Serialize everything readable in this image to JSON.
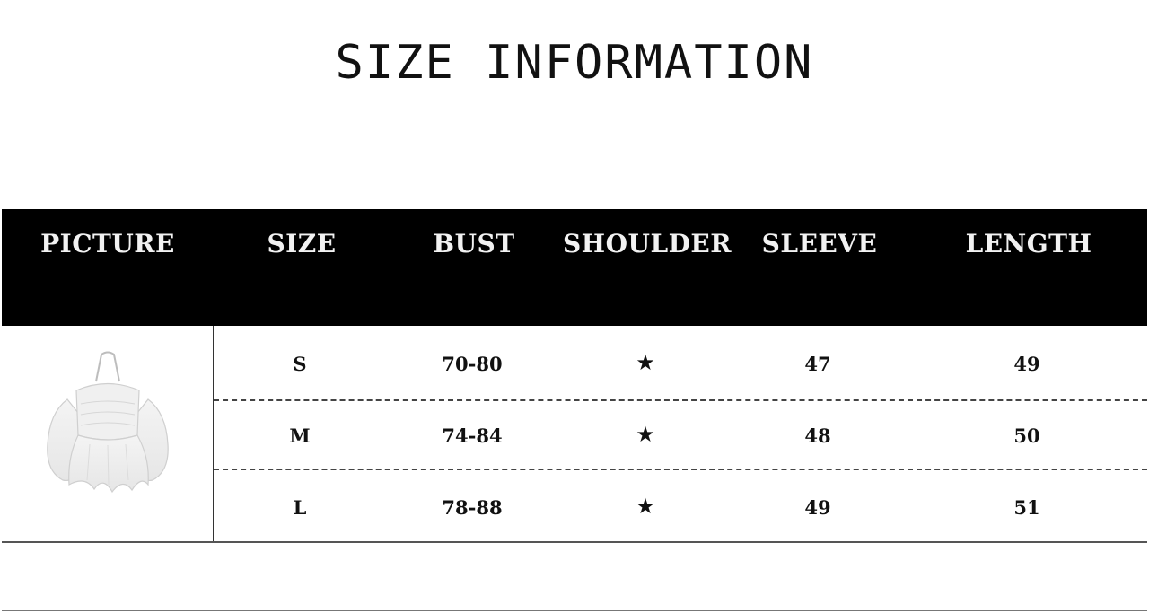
{
  "title": "SIZE INFORMATION",
  "table": {
    "headers": [
      "PICTURE",
      "SIZE",
      "BUST",
      "SHOULDER",
      "SLEEVE",
      "LENGTH"
    ],
    "rows": [
      {
        "size": "S",
        "bust": "70-80",
        "shoulder": "★",
        "sleeve": "47",
        "length": "49"
      },
      {
        "size": "M",
        "bust": "74-84",
        "shoulder": "★",
        "sleeve": "48",
        "length": "50"
      },
      {
        "size": "L",
        "bust": "78-88",
        "shoulder": "★",
        "sleeve": "49",
        "length": "51"
      }
    ]
  },
  "picture": {
    "icon": "off-shoulder-blouse-illustration"
  },
  "colors": {
    "header_bg": "#000000",
    "header_text": "#f2f2f2",
    "body_text": "#111111",
    "background": "#ffffff"
  }
}
